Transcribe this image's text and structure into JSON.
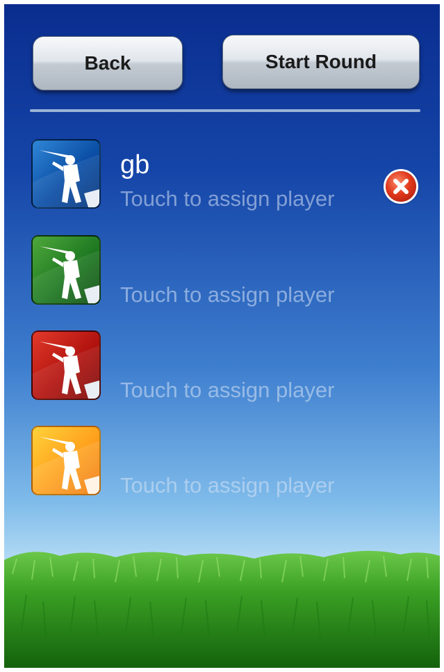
{
  "toolbar": {
    "back_label": "Back",
    "start_label": "Start Round"
  },
  "players": [
    {
      "name": "gb",
      "hint": "Touch to assign player",
      "color": "blue",
      "icon": "golfer-icon",
      "removable": true
    },
    {
      "name": "",
      "hint": "Touch to assign player",
      "color": "green",
      "icon": "golfer-icon",
      "removable": false
    },
    {
      "name": "",
      "hint": "Touch to assign player",
      "color": "red",
      "icon": "golfer-icon",
      "removable": false
    },
    {
      "name": "",
      "hint": "Touch to assign player",
      "color": "orange",
      "icon": "golfer-icon",
      "removable": false
    }
  ],
  "colors": {
    "sky_top": "#0a2d8f",
    "sky_bottom": "#d8eefa",
    "grass": "#2f9a1c",
    "delete_red": "#e1391c"
  },
  "icons": {
    "delete": "delete-x-icon",
    "avatar": "golfer-icon"
  }
}
